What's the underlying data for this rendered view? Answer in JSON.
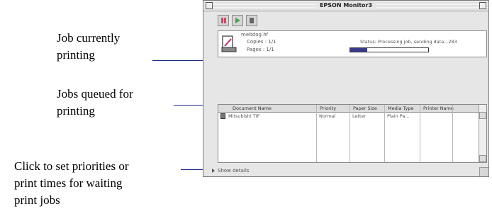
{
  "callouts": {
    "current_line1": "Job currently",
    "current_line2": "printing",
    "queued_line1": "Jobs queued for",
    "queued_line2": "printing",
    "details_line1": "Click to set priorities or",
    "details_line2": "print times for waiting",
    "details_line3": "print jobs"
  },
  "window": {
    "title": "EPSON Monitor3"
  },
  "toolbar": {
    "pause": "pause-icon",
    "resume": "play-icon",
    "delete": "trash-icon"
  },
  "current_job": {
    "name": "meltdog.hf",
    "copies": "Copies : 1/1",
    "pages": "Pages : 1/1",
    "status": "Status: Processing job, sending data...283",
    "progress": 0.22
  },
  "queue": {
    "columns": [
      "Document Name",
      "Priority",
      "Paper Size",
      "Media Type",
      "Printer Name"
    ],
    "rows": [
      {
        "document": "Mitsubishi TIF",
        "priority": "Normal",
        "paper": "Letter",
        "media": "Plain Pa...",
        "printer": ""
      }
    ]
  },
  "details_toggle": "Show details"
}
